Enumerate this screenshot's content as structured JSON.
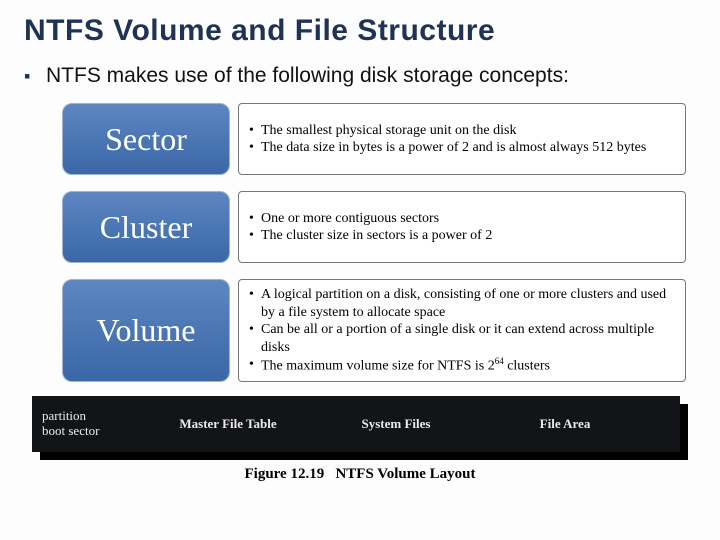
{
  "title": "NTFS Volume and File Structure",
  "intro": "NTFS makes use of the following disk storage concepts:",
  "concepts": [
    {
      "name": "Sector",
      "bullets": [
        "The smallest physical storage unit on the disk",
        "The data size in bytes is a power of 2 and is almost always 512 bytes"
      ]
    },
    {
      "name": "Cluster",
      "bullets": [
        "One or more contiguous sectors",
        "The cluster size in sectors is a power of 2"
      ]
    },
    {
      "name": "Volume",
      "bullets": [
        "A logical partition on a disk, consisting of one or more clusters and used by a file system to allocate space",
        "Can be all or a portion of a single disk or it can extend across multiple disks",
        "The maximum volume size for NTFS is 2^64 clusters"
      ]
    }
  ],
  "volume_layout": {
    "partition": "partition boot sector",
    "mft": "Master File Table",
    "sys": "System Files",
    "filearea": "File Area"
  },
  "figure_caption_label": "Figure 12.19",
  "figure_caption_text": "NTFS Volume Layout"
}
